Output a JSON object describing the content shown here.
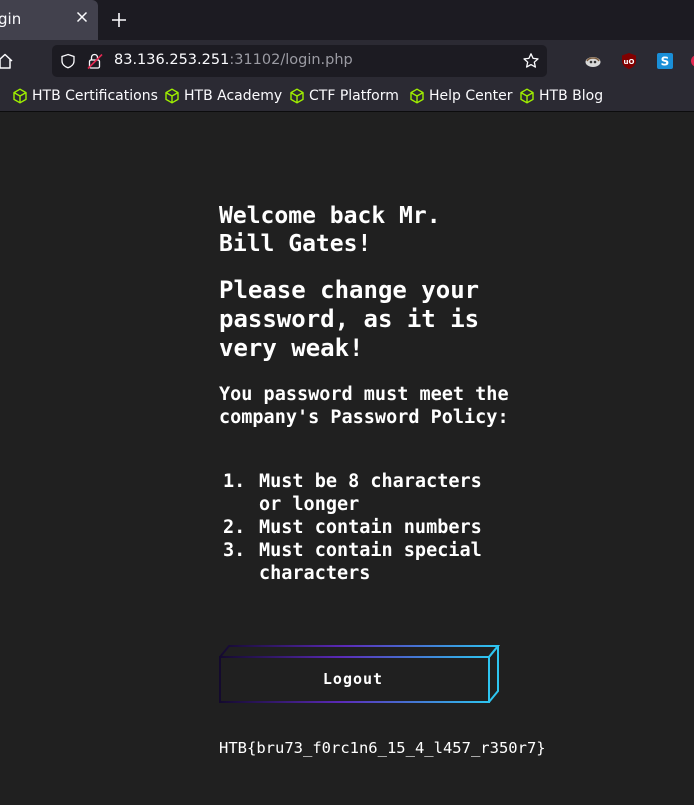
{
  "browser": {
    "tab_title": "gin",
    "url_host": "83.136.253.251",
    "url_rest": ":31102/login.php"
  },
  "bookmarks": [
    {
      "label": "HTB Certifications"
    },
    {
      "label": "HTB Academy"
    },
    {
      "label": "CTF Platform"
    },
    {
      "label": "Help Center"
    },
    {
      "label": "HTB Blog"
    }
  ],
  "page": {
    "welcome": "Welcome back Mr. Bill Gates!",
    "change_prompt": "Please change your password, as it is very weak!",
    "policy_intro": "You password must meet the company's Password Policy:",
    "policy_items": [
      {
        "num": "1.",
        "text": "Must be 8 characters or longer"
      },
      {
        "num": "2.",
        "text": "Must contain numbers"
      },
      {
        "num": "3.",
        "text": "Must contain special characters"
      }
    ],
    "logout_label": "Logout",
    "flag": "HTB{bru73_f0rc1n6_15_4_l457_r350r7}"
  },
  "colors": {
    "page_bg": "#202020",
    "accent_cyan": "#2ec5f0",
    "accent_purple": "#5b2ab8",
    "bookmark_icon": "#9fef00"
  },
  "icons": [
    "close-icon",
    "plus-icon",
    "home-icon",
    "shield-icon",
    "lock-icon",
    "star-icon",
    "extension-icon",
    "ublock-icon",
    "s-extension-icon",
    "htb-cube-icon"
  ]
}
